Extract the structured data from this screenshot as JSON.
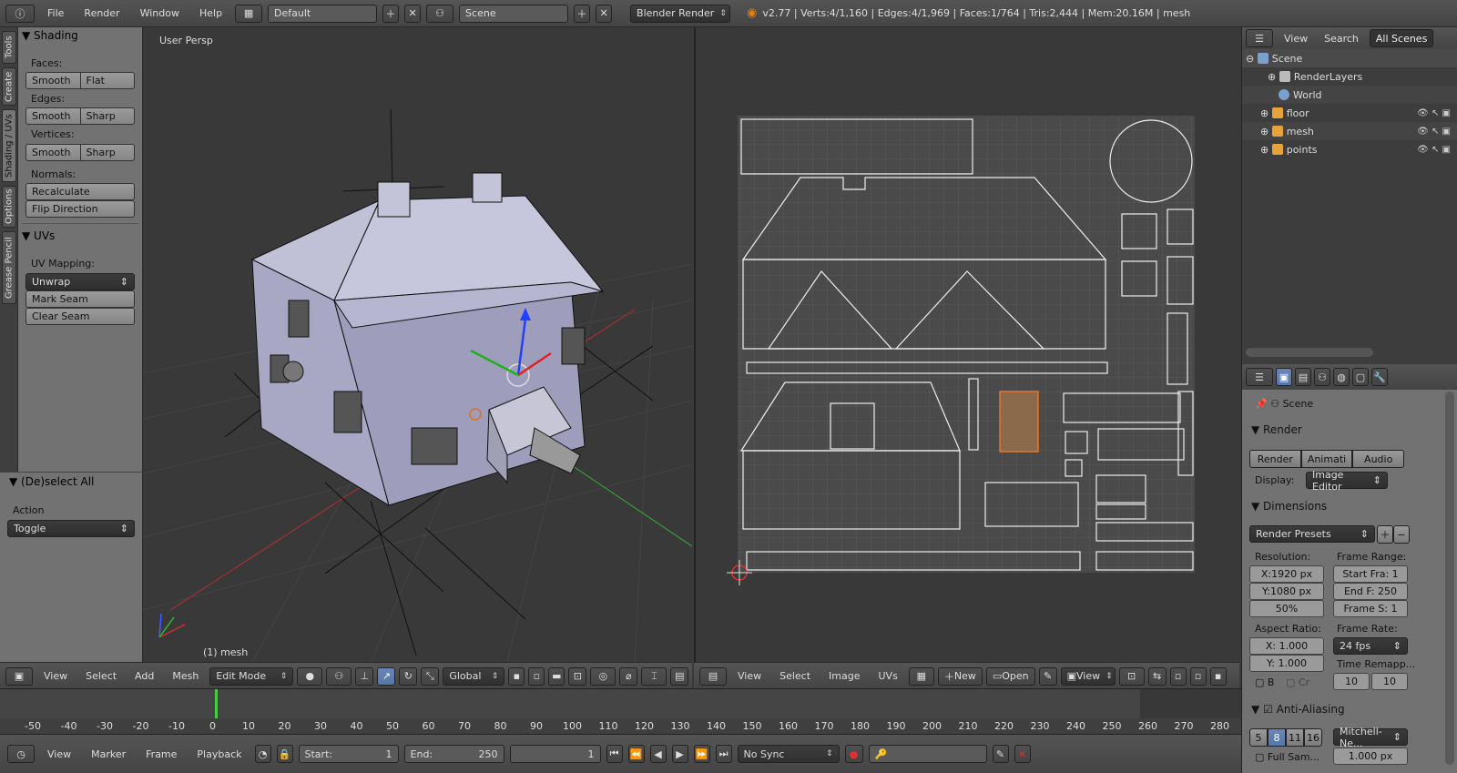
{
  "topbar": {
    "menus": [
      "File",
      "Render",
      "Window",
      "Help"
    ],
    "layout": "Default",
    "scene": "Scene",
    "engine": "Blender Render",
    "stats": "v2.77 | Verts:4/1,160 | Edges:4/1,969 | Faces:1/764 | Tris:2,444 | Mem:20.16M | mesh"
  },
  "tabs": [
    "Tools",
    "Create",
    "Shading / UVs",
    "Options",
    "Grease Pencil"
  ],
  "shading": {
    "title": "Shading",
    "faces_label": "Faces:",
    "faces": [
      "Smooth",
      "Flat"
    ],
    "edges_label": "Edges:",
    "edges": [
      "Smooth",
      "Sharp"
    ],
    "vertices_label": "Vertices:",
    "vertices": [
      "Smooth",
      "Sharp"
    ],
    "normals_label": "Normals:",
    "recalc": "Recalculate",
    "flip": "Flip Direction"
  },
  "uvs": {
    "title": "UVs",
    "mapping_label": "UV Mapping:",
    "mapping": "Unwrap",
    "mark_seam": "Mark Seam",
    "clear_seam": "Clear Seam"
  },
  "operator": {
    "title": "(De)select All",
    "action_label": "Action",
    "action": "Toggle"
  },
  "view3d": {
    "persp": "User Persp",
    "object": "(1) mesh",
    "header": {
      "menus": [
        "View",
        "Select",
        "Add",
        "Mesh"
      ],
      "mode": "Edit Mode",
      "orientation": "Global"
    }
  },
  "uv_editor": {
    "header": {
      "menus": [
        "View",
        "Select",
        "Image",
        "UVs"
      ],
      "new": "New",
      "open": "Open",
      "view": "View"
    }
  },
  "outliner": {
    "header": {
      "view": "View",
      "search": "Search",
      "scenes": "All Scenes"
    },
    "items": [
      {
        "name": "Scene",
        "icon_color": "#7aa0d0"
      },
      {
        "name": "RenderLayers",
        "icon_color": "#bbbbbb"
      },
      {
        "name": "World",
        "icon_color": "#7aa0d0"
      },
      {
        "name": "floor",
        "icon_color": "#e8a23a"
      },
      {
        "name": "mesh",
        "icon_color": "#e8a23a"
      },
      {
        "name": "points",
        "icon_color": "#e8a23a"
      }
    ]
  },
  "properties": {
    "scene": "Scene",
    "render_title": "Render",
    "render_btns": [
      "Render",
      "Animati",
      "Audio"
    ],
    "display_label": "Display:",
    "display": "Image Editor",
    "dimensions_title": "Dimensions",
    "presets": "Render Presets",
    "resolution_label": "Resolution:",
    "frame_range_label": "Frame Range:",
    "res_x": "X:1920 px",
    "res_y": "Y:1080 px",
    "res_pct": "50%",
    "start": "Start Fra: 1",
    "end": "End F: 250",
    "step": "Frame S: 1",
    "aspect_label": "Aspect Ratio:",
    "frame_rate_label": "Frame Rate:",
    "asp_x": "X:   1.000",
    "asp_y": "Y:   1.000",
    "fps": "24 fps",
    "time_remap_label": "Time Remapp...",
    "b_label": "B",
    "cr_label": "Cr",
    "remap_old": "10",
    "remap_new": "10",
    "aa_title": "Anti-Aliasing",
    "aa_samples": [
      "5",
      "8",
      "11",
      "16"
    ],
    "aa_filter": "Mitchell-Ne...",
    "full_sample": "Full Sam...",
    "filter_size": "1.000 px"
  },
  "timeline": {
    "ticks": [
      "-50",
      "-40",
      "-30",
      "-20",
      "-10",
      "0",
      "10",
      "20",
      "30",
      "40",
      "50",
      "60",
      "70",
      "80",
      "90",
      "100",
      "110",
      "120",
      "130",
      "140",
      "150",
      "160",
      "170",
      "180",
      "190",
      "200",
      "210",
      "220",
      "230",
      "240",
      "250",
      "260",
      "270",
      "280"
    ],
    "header": {
      "menus": [
        "View",
        "Marker",
        "Frame",
        "Playback"
      ],
      "start": "Start:",
      "start_val": "1",
      "end": "End:",
      "end_val": "250",
      "current": "1",
      "sync": "No Sync"
    }
  }
}
